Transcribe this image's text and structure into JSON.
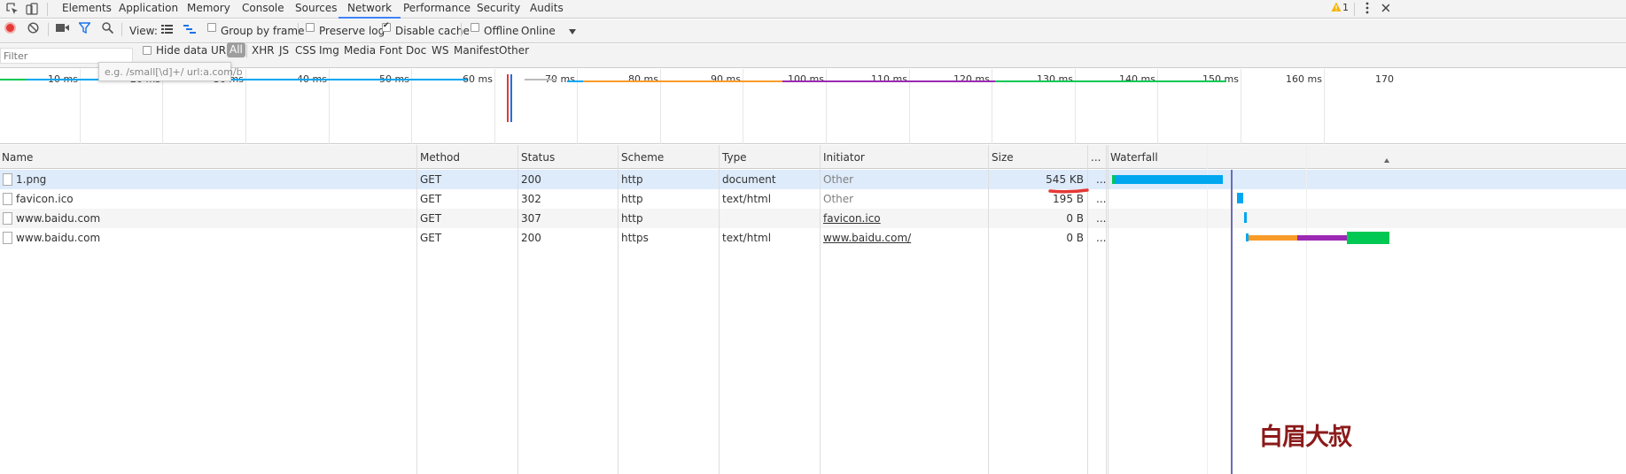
{
  "tabs": [
    "Elements",
    "Application",
    "Memory",
    "Console",
    "Sources",
    "Network",
    "Performance",
    "Security",
    "Audits"
  ],
  "active_tab": "Network",
  "warning_count": "1",
  "toolbar": {
    "view_label": "View:",
    "group_by_frame": "Group by frame",
    "preserve_log": "Preserve log",
    "disable_cache": "Disable cache",
    "offline": "Offline",
    "throttle_value": "Online"
  },
  "filterbar": {
    "filter_placeholder": "Filter",
    "hide_data_urls": "Hide data URLs",
    "types": [
      "All",
      "XHR",
      "JS",
      "CSS",
      "Img",
      "Media",
      "Font",
      "Doc",
      "WS",
      "Manifest",
      "Other"
    ],
    "tooltip": "e.g. /small[\\d]+/ url:a.com/b"
  },
  "overview": {
    "ticks": [
      "10 ms",
      "20 ms",
      "30 ms",
      "40 ms",
      "50 ms",
      "60 ms",
      "70 ms",
      "80 ms",
      "90 ms",
      "100 ms",
      "110 ms",
      "120 ms",
      "130 ms",
      "140 ms",
      "150 ms",
      "160 ms",
      "170"
    ]
  },
  "columns": [
    "Name",
    "Method",
    "Status",
    "Scheme",
    "Type",
    "Initiator",
    "Size",
    "...",
    "Waterfall"
  ],
  "rows": [
    {
      "name": "1.png",
      "method": "GET",
      "status": "200",
      "scheme": "http",
      "type": "document",
      "initiator": "Other",
      "size": "545 KB",
      "more": "..."
    },
    {
      "name": "favicon.ico",
      "method": "GET",
      "status": "302",
      "scheme": "http",
      "type": "text/html",
      "initiator": "Other",
      "size": "195 B",
      "more": "..."
    },
    {
      "name": "www.baidu.com",
      "method": "GET",
      "status": "307",
      "scheme": "http",
      "type": "",
      "initiator": "favicon.ico",
      "size": "0 B",
      "more": "..."
    },
    {
      "name": "www.baidu.com",
      "method": "GET",
      "status": "200",
      "scheme": "https",
      "type": "text/html",
      "initiator": "www.baidu.com/",
      "size": "0 B",
      "more": "..."
    }
  ],
  "watermark": "白眉大叔",
  "colors": {
    "accent": "#3e82f7",
    "record": "#e53935",
    "selected_row": "#deebfb",
    "waiting": "#00a6f0",
    "ssl": "#f89b29",
    "server": "#9b29b3",
    "download": "#00c853",
    "watermark": "#8b1a1a"
  }
}
